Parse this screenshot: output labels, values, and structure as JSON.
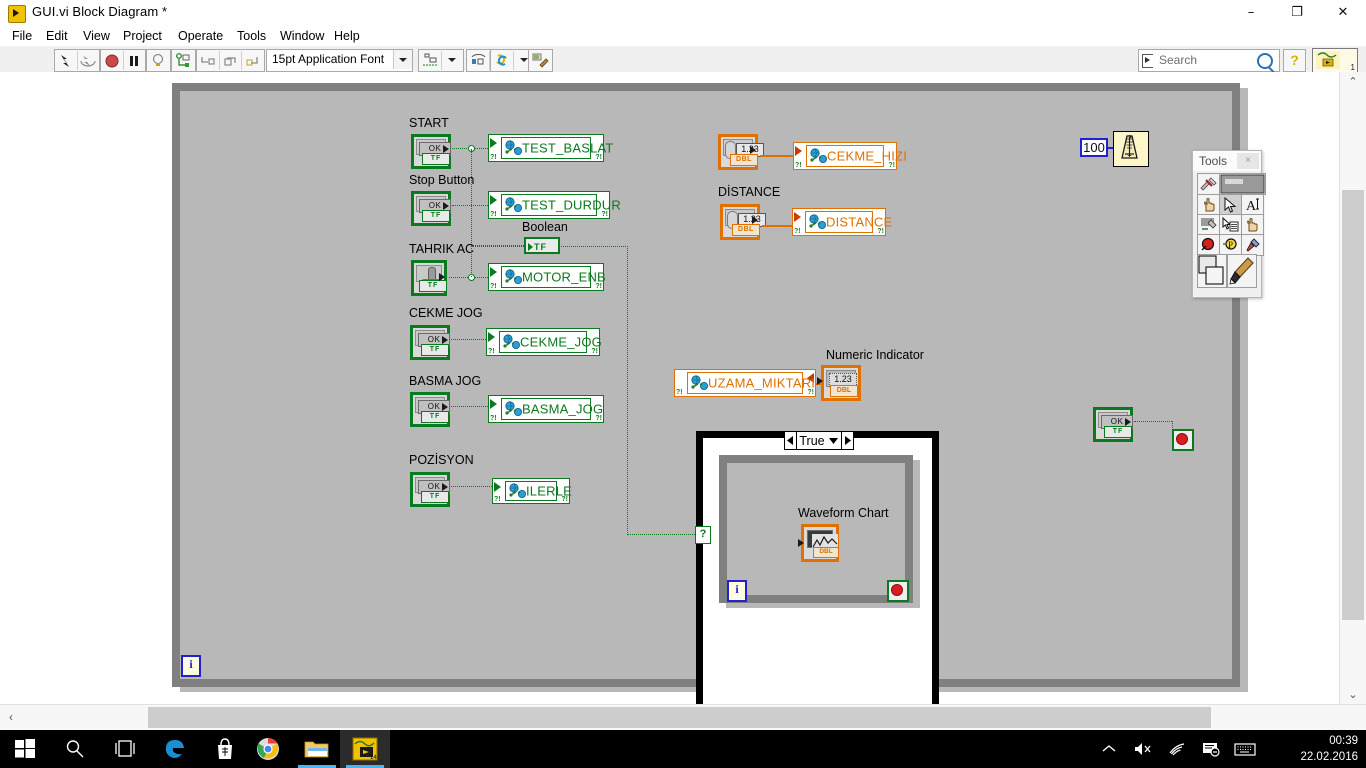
{
  "window": {
    "title": "GUI.vi Block Diagram *",
    "icon": "labview-vi-icon",
    "minimize": "–",
    "maximize": "❐",
    "close": "✕"
  },
  "menu": [
    {
      "label": "File"
    },
    {
      "label": "Edit"
    },
    {
      "label": "View"
    },
    {
      "label": "Project"
    },
    {
      "label": "Operate"
    },
    {
      "label": "Tools"
    },
    {
      "label": "Window"
    },
    {
      "label": "Help"
    }
  ],
  "toolbar": {
    "run_label": "run-arrow",
    "run_continuous_label": "run-continuously",
    "abort_label": "abort-execution",
    "pause_label": "pause",
    "highlight_label": "highlight-execution",
    "probe_label": "retain-wire-values",
    "stepinto_label": "step-into",
    "stepover_label": "step-over",
    "stepout_label": "step-out",
    "font": "15pt Application Font",
    "align_label": "align-objects",
    "distribute_label": "distribute-objects",
    "reorder_label": "reorder",
    "cleanup_label": "clean-up-diagram",
    "search_placeholder": "Search",
    "help_label": "?",
    "vi_number": "1"
  },
  "diagram": {
    "controls": [
      {
        "label": "START",
        "terminal": "OK",
        "tf": "TF",
        "kind": "ok-button"
      },
      {
        "label": "Stop Button",
        "terminal": "OK",
        "tf": "TF",
        "kind": "ok-button"
      },
      {
        "label": "TAHRIK AC",
        "terminal": "",
        "tf": "TF",
        "kind": "toggle-switch"
      },
      {
        "label": "CEKME JOG",
        "terminal": "OK",
        "tf": "TF",
        "kind": "ok-button"
      },
      {
        "label": "BASMA JOG",
        "terminal": "OK",
        "tf": "TF",
        "kind": "ok-button"
      },
      {
        "label": "POZİSYON",
        "terminal": "OK",
        "tf": "TF",
        "kind": "ok-button"
      }
    ],
    "shared_variables": [
      {
        "name": "TEST_BASLAT",
        "color": "#0a7a1e"
      },
      {
        "name": "TEST_DURDUR",
        "color": "#0a7a1e"
      },
      {
        "name": "MOTOR_ENB",
        "color": "#0a7a1e"
      },
      {
        "name": "CEKME_JOG",
        "color": "#0a7a1e"
      },
      {
        "name": "BASMA_JOG",
        "color": "#0a7a1e"
      },
      {
        "name": "ILERLE",
        "color": "#0a7a1e"
      },
      {
        "name": "CEKME_HIZI",
        "color": "#e07000"
      },
      {
        "name": "DISTANCE",
        "color": "#e07000"
      },
      {
        "name": "UZAMA_MIKTARI",
        "color": "#e07000"
      }
    ],
    "boolean_indicator": {
      "label": "Boolean",
      "tf": "TF"
    },
    "numeric_controls": [
      {
        "label": "",
        "value": "1.23",
        "rep": "DBL"
      },
      {
        "label": "DİSTANCE",
        "value": "1.23",
        "rep": "DBL"
      }
    ],
    "numeric_indicator": {
      "label": "Numeric Indicator",
      "value": "1.23",
      "rep": "DBL"
    },
    "case_structure": {
      "selector": "True",
      "left_arrow": "◀",
      "right_arrow": "▶",
      "dropdown": "▼",
      "selector_terminal": "?"
    },
    "waveform_chart": {
      "label": "Waveform Chart",
      "rep": "DBL"
    },
    "inner_loop": {
      "iteration": "i",
      "stop": "stop-sign"
    },
    "outer_loop": {
      "iteration": "i"
    },
    "wait_function": {
      "constant": "100",
      "icon": "metronome-wait-ms"
    },
    "stop_terminal": {
      "label": "OK",
      "tf": "TF"
    }
  },
  "tools_palette": {
    "title": "Tools",
    "close": "×",
    "rows": [
      [
        {
          "name": "automatic-tool-selection-icon"
        },
        {
          "name": "automatic-tool-indicator"
        }
      ],
      [
        {
          "name": "operate-value-icon"
        },
        {
          "name": "position-size-select-icon",
          "selected": true
        },
        {
          "name": "edit-text-icon"
        }
      ],
      [
        {
          "name": "connect-wire-icon"
        },
        {
          "name": "object-shortcut-menu-icon"
        },
        {
          "name": "scroll-window-icon"
        }
      ],
      [
        {
          "name": "set-clear-breakpoint-icon"
        },
        {
          "name": "probe-data-icon"
        },
        {
          "name": "get-set-color-icon"
        }
      ],
      [
        {
          "name": "set-color-icon"
        },
        {
          "name": "paint-brush-icon"
        }
      ]
    ]
  },
  "scrollbars": {
    "up": "⌃",
    "down": "⌄",
    "left": "‹",
    "right": "›"
  },
  "taskbar": {
    "items": [
      {
        "name": "start-button-icon"
      },
      {
        "name": "search-icon"
      },
      {
        "name": "task-view-icon"
      },
      {
        "name": "edge-browser-icon"
      },
      {
        "name": "microsoft-store-icon"
      },
      {
        "name": "google-chrome-icon"
      },
      {
        "name": "file-explorer-icon"
      },
      {
        "name": "labview-icon"
      }
    ],
    "tray": [
      {
        "name": "show-hidden-icons-icon",
        "glyph": "⌃"
      },
      {
        "name": "volume-muted-icon",
        "glyph": "🔇"
      },
      {
        "name": "network-wifi-icon",
        "glyph": "📶"
      },
      {
        "name": "action-center-icon",
        "glyph": "▤"
      },
      {
        "name": "touch-keyboard-icon",
        "glyph": "⌨"
      }
    ],
    "time": "00:39",
    "date": "22.02.2016"
  }
}
